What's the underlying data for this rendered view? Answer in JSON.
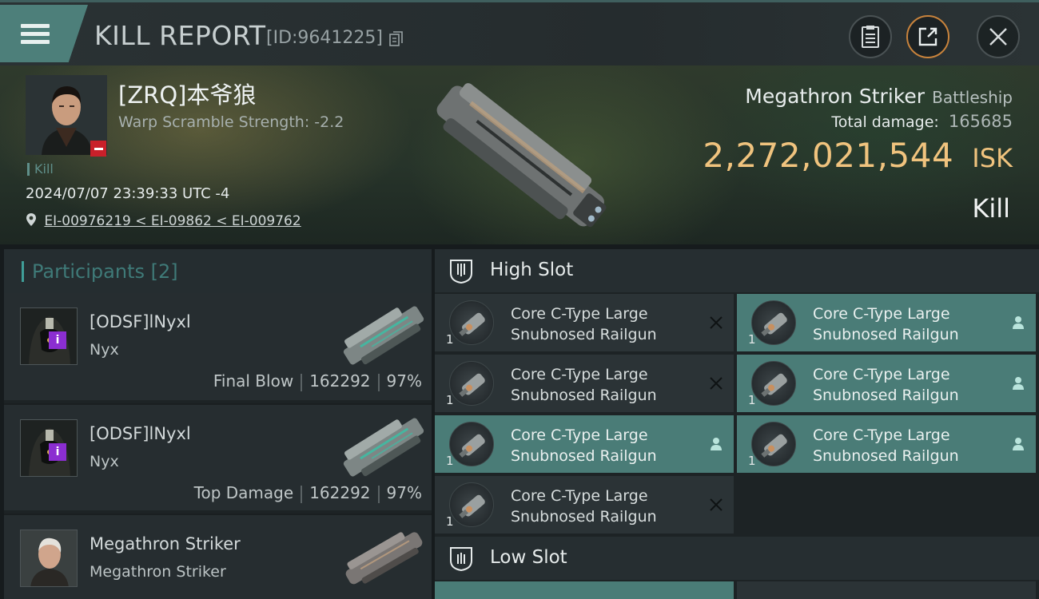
{
  "topbar": {
    "title": "KILL REPORT",
    "report_id": "[ID:9641225]",
    "icons": [
      "menu-icon",
      "copy-icon",
      "clipboard-icon",
      "share-icon",
      "close-icon"
    ]
  },
  "victim": {
    "name": "[ZRQ]本爷狼",
    "warp_scramble": "Warp Scramble Strength: -2.2",
    "tag": "Kill",
    "datetime": "2024/07/07 23:39:33 UTC -4",
    "location_path": "EI-00976219 < EI-09862 < EI-009762",
    "ship_name": "Megathron Striker",
    "ship_class": "Battleship",
    "total_damage_label": "Total damage:",
    "total_damage": "165685",
    "isk_value": "2,272,021,544",
    "isk_unit": "ISK",
    "result": "Kill"
  },
  "participants": {
    "header": "Participants [2]",
    "rows": [
      {
        "name": "[ODSF]lNyxl",
        "ship": "Nyx",
        "role": "Final Blow",
        "damage": "162292",
        "percent": "97%",
        "badge": "i"
      },
      {
        "name": "[ODSF]lNyxl",
        "ship": "Nyx",
        "role": "Top Damage",
        "damage": "162292",
        "percent": "97%",
        "badge": "i"
      },
      {
        "name": "Megathron Striker",
        "ship": "Megathron Striker",
        "role": "",
        "damage": "",
        "percent": ""
      }
    ]
  },
  "slots": {
    "high_title": "High Slot",
    "low_title": "Low Slot",
    "high_modules": [
      {
        "line1": "Core C-Type Large",
        "line2": "Snubnosed Railgun",
        "qty": "1",
        "status": "destroyed"
      },
      {
        "line1": "Core C-Type Large",
        "line2": "Snubnosed Railgun",
        "qty": "1",
        "status": "dropped"
      },
      {
        "line1": "Core C-Type Large",
        "line2": "Snubnosed Railgun",
        "qty": "1",
        "status": "destroyed"
      },
      {
        "line1": "Core C-Type Large",
        "line2": "Snubnosed Railgun",
        "qty": "1",
        "status": "dropped"
      },
      {
        "line1": "Core C-Type Large",
        "line2": "Snubnosed Railgun",
        "qty": "1",
        "status": "dropped"
      },
      {
        "line1": "Core C-Type Large",
        "line2": "Snubnosed Railgun",
        "qty": "1",
        "status": "dropped"
      },
      {
        "line1": "Core C-Type Large",
        "line2": "Snubnosed Railgun",
        "qty": "1",
        "status": "destroyed"
      }
    ]
  },
  "colors": {
    "accent_teal": "#4a7c77",
    "isk_gold": "#f0c37e",
    "status_red": "#c9202a",
    "badge_purple": "#8b2ed1"
  }
}
